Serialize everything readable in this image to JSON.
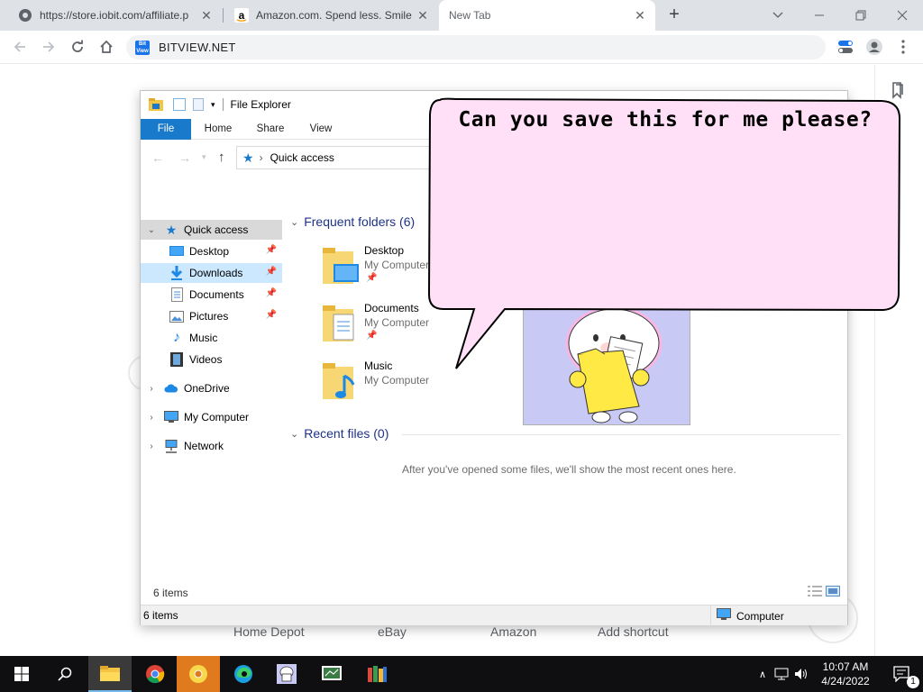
{
  "browser": {
    "tabs": [
      {
        "title": "https://store.iobit.com/affiliate.p",
        "favicon": "globe-icon",
        "active": false
      },
      {
        "title": "Amazon.com. Spend less. Smile m",
        "favicon": "amazon-icon",
        "active": false
      },
      {
        "title": "New Tab",
        "favicon": "",
        "active": true
      }
    ],
    "address": "BITVIEW.NET",
    "site_badge": "Bit View"
  },
  "ntp": {
    "shortcuts": [
      "Home Depot",
      "eBay",
      "Amazon",
      "Add shortcut"
    ]
  },
  "explorer": {
    "title": "File Explorer",
    "ribbon_tabs": [
      "File",
      "Home",
      "Share",
      "View"
    ],
    "address_path": "Quick access",
    "nav": {
      "quick_access": "Quick access",
      "pinned": [
        "Desktop",
        "Downloads",
        "Documents",
        "Pictures"
      ],
      "others": [
        "Music",
        "Videos"
      ],
      "onedrive": "OneDrive",
      "my_computer": "My Computer",
      "network": "Network"
    },
    "frequent_header": "Frequent folders (6)",
    "frequent": [
      {
        "name": "Desktop",
        "location": "My Computer",
        "pinned": true
      },
      {
        "name": "Documents",
        "location": "My Computer",
        "pinned": true
      },
      {
        "name": "Music",
        "location": "My Computer",
        "pinned": false
      }
    ],
    "recent_header": "Recent files (0)",
    "recent_empty": "After you've opened some files, we'll show the most recent ones here.",
    "item_count": "6 items",
    "status_count": "6 items",
    "status_location": "Computer"
  },
  "bubble": {
    "text": "Can you save this for me please?"
  },
  "taskbar": {
    "time": "10:07 AM",
    "date": "4/24/2022",
    "notification_count": "1"
  },
  "colors": {
    "accent": "#1979ca",
    "bubble_fill": "#ffe0f7",
    "sticker_bg": "#c9c9f5",
    "taskbar": "#0f0f12"
  }
}
